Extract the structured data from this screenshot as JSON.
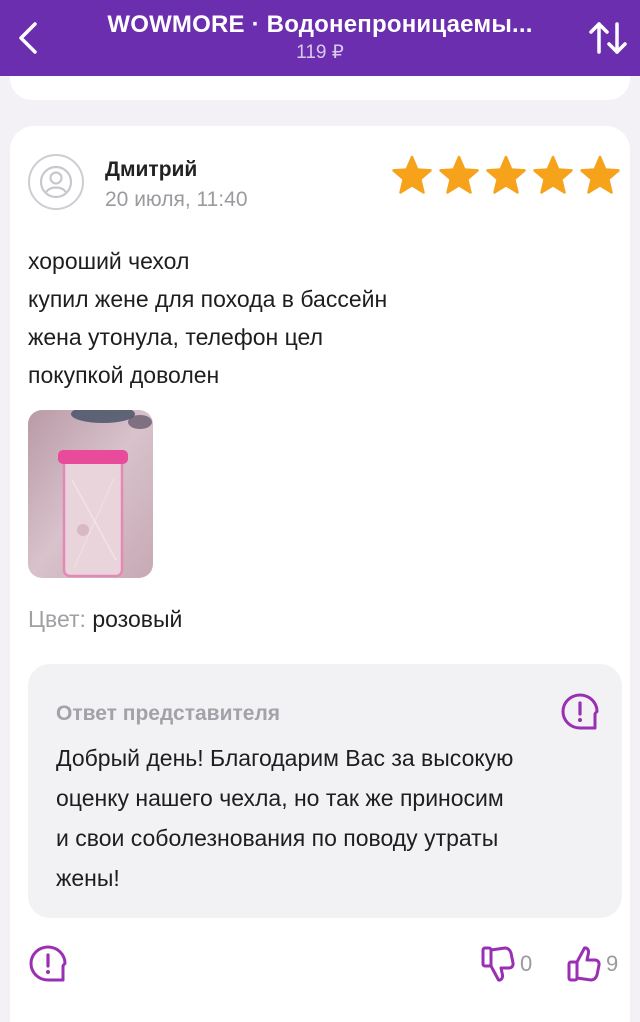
{
  "header": {
    "title": "WOWMORE · Водонепроницаемы...",
    "price": "119 ₽",
    "back_icon": "chevron-left-icon",
    "sort_icon": "sort-arrows-icon"
  },
  "review": {
    "author": "Дмитрий",
    "date": "20 июля, 11:40",
    "rating": 5,
    "text_lines": [
      "хороший чехол",
      "купил жене для похода в бассейн",
      "жена утонула, телефон цел",
      "покупкой доволен"
    ],
    "color_label": "Цвет:",
    "color_value": "розовый"
  },
  "reply": {
    "title": "Ответ представителя",
    "text_lines": [
      "Добрый день! Благодарим Вас за высокую",
      "оценку нашего чехла, но так же приносим",
      "и свои соболезнования по поводу утраты",
      "жены!"
    ]
  },
  "actions": {
    "dislike_count": "0",
    "like_count": "9"
  },
  "colors": {
    "brand": "#6a2eae",
    "star": "#f7a21b",
    "accent_icon": "#9a2fb4"
  }
}
